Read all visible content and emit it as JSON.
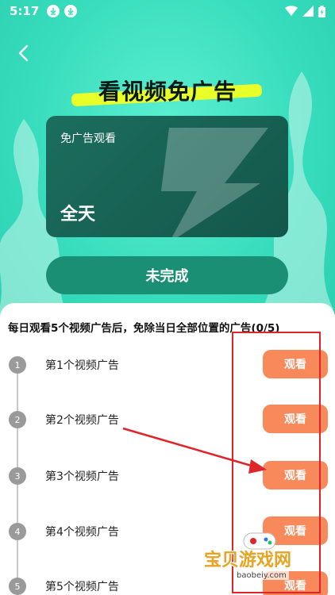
{
  "status_bar": {
    "time": "5:17",
    "icons": [
      "download-icon",
      "download-icon",
      "wifi-icon",
      "signal-icon",
      "battery-charging-icon"
    ]
  },
  "header": {
    "title": "看视频免广告"
  },
  "card": {
    "label": "免广告观看",
    "value": "全天"
  },
  "status_button": {
    "label": "未完成"
  },
  "tasks": {
    "title": "每日观看5个视频广告后，免除当日全部位置的广告(0/5)",
    "progress": {
      "done": 0,
      "total": 5
    },
    "items": [
      {
        "step": "1",
        "label": "第1个视频广告",
        "button": "观看"
      },
      {
        "step": "2",
        "label": "第2个视频广告",
        "button": "观看"
      },
      {
        "step": "3",
        "label": "第3个视频广告",
        "button": "观看"
      },
      {
        "step": "4",
        "label": "第4个视频广告",
        "button": "观看"
      },
      {
        "step": "5",
        "label": "第5个视频广告",
        "button": "观看"
      }
    ]
  },
  "watermark": {
    "text": "宝贝游戏网",
    "url": "baobeiy.com"
  },
  "colors": {
    "hero_bg": "#3ee0c0",
    "card_bg": "#1b6e5e",
    "button_bg": "#1b8f74",
    "watch_button": "#f8895a",
    "title_highlight": "#e8ff2a",
    "annotation_red": "#e0252a",
    "step_dot": "#9a9a9a"
  }
}
